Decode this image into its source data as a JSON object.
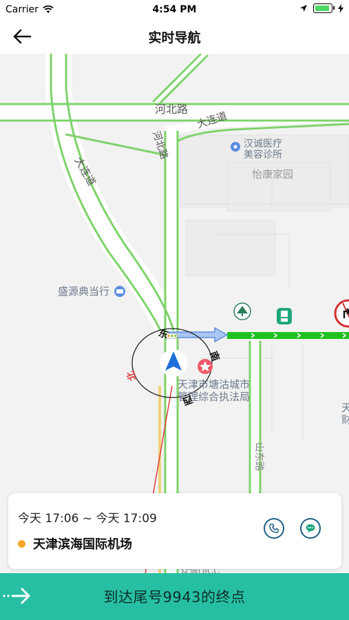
{
  "status_bar": {
    "carrier": "Carrier",
    "time": "4:54 PM"
  },
  "nav": {
    "title": "实时导航"
  },
  "map": {
    "labels": {
      "hebei_road_h": "河北路",
      "dalian_road_upper": "大连道",
      "hebei_road_v": "河北路",
      "dalian_road_diag": "大连道",
      "clinic": "汉诚医疗\n美容诊所",
      "yikang": "怡康家园",
      "pawnshop": "盛源典当行",
      "gov_office": "天津市塘沽城市\n管理综合执法局",
      "shandong_road": "山东路",
      "right_edge": "天\n财",
      "bottom_poi": "众诚DICC"
    },
    "compass": {
      "east": "东",
      "south": "南",
      "west": "西",
      "north": "北"
    }
  },
  "card": {
    "time_range": "今天 17:06 ~ 今天 17:09",
    "destination": "天津滨海国际机场"
  },
  "bottom": {
    "label": "到达尾号9943的终点"
  },
  "colors": {
    "accent": "#27bfa4",
    "road_green": "#7ed36a",
    "route": "#1ec21e",
    "dot": "#f5a623"
  },
  "icons": [
    "back-arrow-icon",
    "wifi-icon",
    "location-arrow-icon",
    "battery-icon",
    "phone-icon",
    "message-icon",
    "slide-arrow-icon",
    "nav-arrow-icon",
    "tree-icon",
    "bus-icon",
    "no-turn-sign-icon",
    "clinic-icon",
    "pawnshop-icon",
    "gov-star-icon"
  ]
}
